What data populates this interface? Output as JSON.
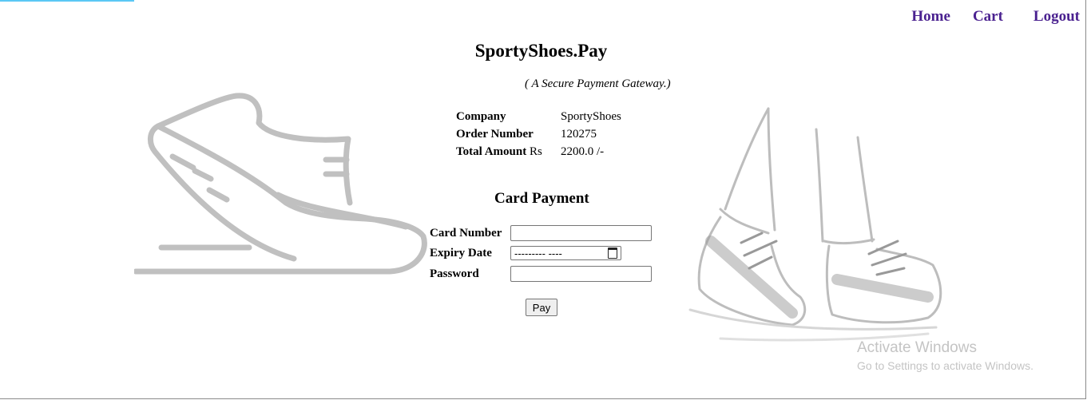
{
  "nav": {
    "home": "Home",
    "cart": "Cart",
    "logout": "Logout"
  },
  "header": {
    "title": "SportyShoes.Pay",
    "subtitle": "( A Secure Payment Gateway.)"
  },
  "order": {
    "company_label": "Company",
    "company_value": "SportyShoes",
    "order_label": "Order Number",
    "order_value": "120275",
    "amount_label": "Total Amount",
    "amount_unit": "Rs",
    "amount_value": "2200.0 /-"
  },
  "card": {
    "heading": "Card Payment",
    "card_number_label": "Card Number",
    "expiry_label": "Expiry Date",
    "expiry_placeholder": "---------  ----",
    "password_label": "Password",
    "pay_button": "Pay"
  },
  "watermark": {
    "line1": "Activate Windows",
    "line2": "Go to Settings to activate Windows."
  },
  "icons": {
    "left_illustration": "running-shoe-icon",
    "right_illustration": "walking-feet-icon",
    "calendar": "calendar-icon"
  },
  "colors": {
    "nav": "#4b2290",
    "illustration": "#c0c0c0",
    "top_bar": "#5bc8f5"
  }
}
